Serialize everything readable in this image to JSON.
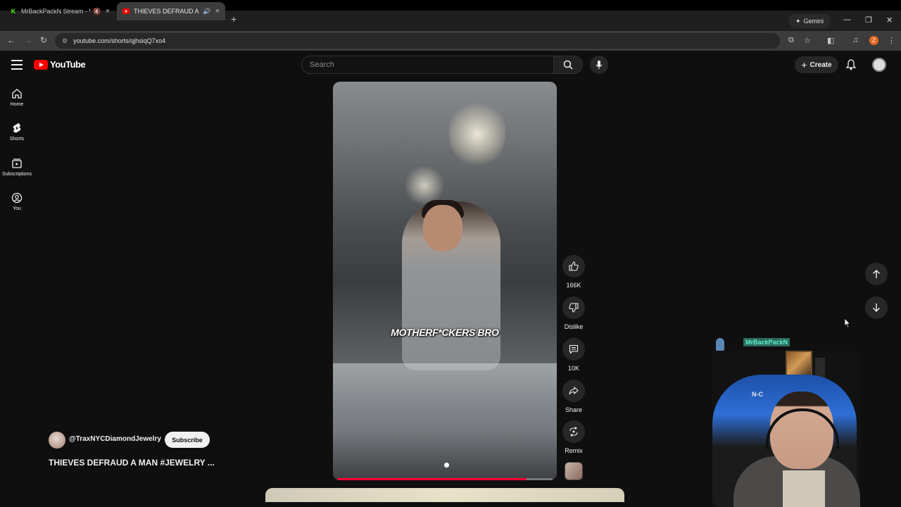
{
  "browser": {
    "tabs": [
      {
        "title": "MrBackPackN Stream - Wa",
        "active": false,
        "favicon": "kick-icon"
      },
      {
        "title": "THIEVES DEFRAUD A MAN",
        "active": true,
        "favicon": "youtube-icon"
      }
    ],
    "gemini_label": "Gemini",
    "url": "youtube.com/shorts/qjhsiqQ7xo4",
    "profile_initial": "Z"
  },
  "youtube": {
    "logo_text": "YouTube",
    "search_placeholder": "Search",
    "create_label": "Create",
    "guide": [
      {
        "label": "Home",
        "icon": "home-icon"
      },
      {
        "label": "Shorts",
        "icon": "shorts-icon"
      },
      {
        "label": "Subscriptions",
        "icon": "subscriptions-icon"
      },
      {
        "label": "You",
        "icon": "you-icon"
      }
    ],
    "short": {
      "caption": "MOTHERF*CKERS BRO",
      "progress": 0.88,
      "channel": "@TraxNYCDiamondJewelry",
      "subscribe_label": "Subscribe",
      "title": "THIEVES DEFRAUD A MAN #JEWELRY ..."
    },
    "actions": [
      {
        "label": "166K",
        "icon": "like-icon"
      },
      {
        "label": "Dislike",
        "icon": "dislike-icon"
      },
      {
        "label": "10K",
        "icon": "comment-icon"
      },
      {
        "label": "Share",
        "icon": "share-icon"
      },
      {
        "label": "Remix",
        "icon": "remix-icon"
      }
    ]
  },
  "overlay": {
    "streamer_tag": "MrBackPackN",
    "chair_logo": "N-C"
  },
  "colors": {
    "youtube_red": "#ff0000",
    "progress_red": "#ff0033",
    "background": "#0f0f0f"
  }
}
